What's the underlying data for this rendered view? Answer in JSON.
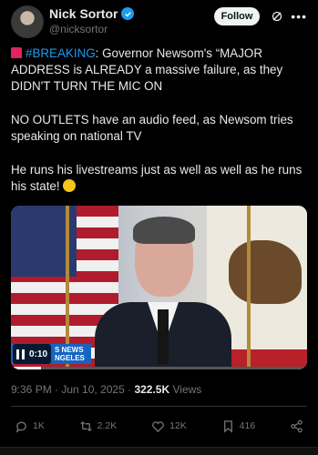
{
  "author": {
    "display_name": "Nick Sortor",
    "handle": "@nicksortor",
    "verified": true,
    "avatar_icon": "avatar-photo"
  },
  "header": {
    "follow_label": "Follow",
    "grok_icon": "grok-icon",
    "more_icon": "more-icon"
  },
  "tweet": {
    "hashtag": "#BREAKING",
    "para1_rest": ": Governor Newsom's “MAJOR ADDRESS is ALREADY a massive failure, as they DIDN'T TURN THE MIC ON",
    "para2": "NO OUTLETS have an audio feed, as Newsom tries speaking on national TV",
    "para3": "He runs his livestreams just as well as well as he runs his state!",
    "emoji_icon": "rolling-laughing-emoji"
  },
  "media": {
    "time_elapsed": "0:10",
    "overlay_label_1": "S NEWS",
    "overlay_label_2": "NGELES",
    "progress_fraction": 0.1
  },
  "meta": {
    "time": "9:36 PM",
    "date": "Jun 10, 2025",
    "separator": " · ",
    "views_count": "322.5K",
    "views_label": " Views"
  },
  "actions": {
    "replies": "1K",
    "reposts": "2.2K",
    "likes": "12K",
    "bookmarks": "416"
  },
  "colors": {
    "accent": "#1d9bf0",
    "background": "#000000",
    "muted": "#71767b"
  }
}
